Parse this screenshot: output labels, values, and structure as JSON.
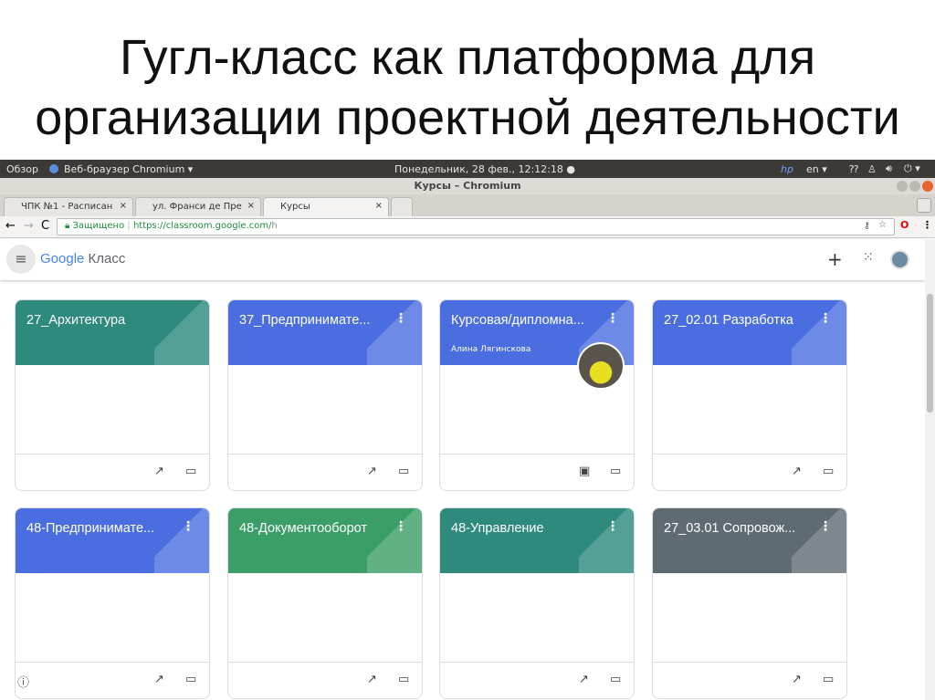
{
  "slide": {
    "title_line1": "Гугл-класс как платформа для",
    "title_line2": "организации проектной деятельности"
  },
  "os": {
    "overview": "Обзор",
    "app": "Веб-браузер Chromium ▾",
    "datetime": "Понедельник, 28 фев., 12:12:18 ●",
    "lang": "en ▾"
  },
  "window": {
    "title": "Курсы – Chromium"
  },
  "tabs": [
    {
      "label": "ЧПК №1 - Расписан"
    },
    {
      "label": "ул. Франси де Пре"
    },
    {
      "label": "Курсы"
    }
  ],
  "address": {
    "secure": "Защищено",
    "url_host": "https://classroom.google.com/",
    "url_path": "h"
  },
  "app": {
    "logo_google": "Google",
    "logo_product": "Класс",
    "add": "+"
  },
  "colors": {
    "teal": "#2d8a7d",
    "blue": "#4a6ee0",
    "green": "#3a9e66",
    "gray": "#5f6b73"
  },
  "courses": [
    {
      "title": "27_Архитектура",
      "color": "teal"
    },
    {
      "title": "37_Предпринимате...",
      "color": "blue"
    },
    {
      "title": "Курсовая/дипломна...",
      "subtitle": "Алина Лягинскова",
      "color": "blue"
    },
    {
      "title": "27_02.01 Разработка",
      "color": "blue"
    },
    {
      "title": "48-Предпринимате...",
      "color": "blue"
    },
    {
      "title": "48-Документооборот",
      "color": "green"
    },
    {
      "title": "48-Управление",
      "color": "teal"
    },
    {
      "title": "27_03.01 Сопровож...",
      "color": "gray"
    }
  ]
}
